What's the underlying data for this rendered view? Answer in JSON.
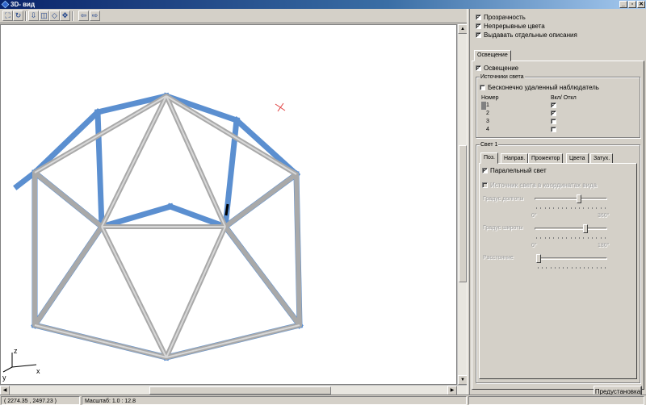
{
  "window": {
    "title": "3D- вид",
    "buttons": [
      "_",
      "▫",
      "✕"
    ]
  },
  "toolbar": {
    "buttons": [
      {
        "icon": "zoom-fit-icon",
        "glyph": "⛶"
      },
      {
        "icon": "refresh-icon",
        "glyph": "↻"
      },
      {
        "icon": "pan-down-icon",
        "glyph": "⇩"
      },
      {
        "icon": "view-front-icon",
        "glyph": "◫"
      },
      {
        "icon": "view-top-icon",
        "glyph": "◇"
      },
      {
        "icon": "move-icon",
        "glyph": "✥"
      },
      {
        "icon": "undo-icon",
        "glyph": "⇦"
      },
      {
        "icon": "redo-icon",
        "glyph": "⇨"
      }
    ]
  },
  "viewport": {
    "axes": {
      "z": "z",
      "x": "x",
      "y": "y"
    }
  },
  "status": {
    "coords": "( 2274.35 , 2497.23 )",
    "scale": "Масштаб: 1.0 : 12.8"
  },
  "panel": {
    "transparency": {
      "label": "Прозрачность",
      "checked": true
    },
    "continuous_colors": {
      "label": "Непрерывные цвета",
      "checked": true
    },
    "separate_desc": {
      "label": "Выдавать отдельные описания",
      "checked": true
    },
    "lighting_tab": "Освещение",
    "lighting": {
      "label": "Освещение",
      "checked": true
    },
    "sources_group": "Источники света",
    "infinite_observer": {
      "label": "Бесконечно удаленный наблюдатель",
      "checked": false
    },
    "list_headers": {
      "num": "Номер",
      "onoff": "Вкл/ Откл"
    },
    "lights": [
      {
        "num": "1",
        "on": true
      },
      {
        "num": "2",
        "on": true
      },
      {
        "num": "3",
        "on": false
      },
      {
        "num": "4",
        "on": false
      }
    ],
    "light_group": "Свет 1",
    "light_tabs": [
      "Поз.",
      "Направ.",
      "Прожектор",
      "Цвета",
      "Затух."
    ],
    "parallel_light": {
      "label": "Паралельный свет",
      "checked": true
    },
    "view_coords": {
      "label": "Источник света в координатах вида",
      "checked": false
    },
    "longitude": {
      "label": "Градус долготы",
      "min": "0°",
      "max": "360°",
      "value_fraction": 0.62
    },
    "latitude": {
      "label": "Градус широты",
      "min": "0°",
      "max": "180°",
      "value_fraction": 0.72
    },
    "distance": {
      "label": "Расстояние",
      "value_fraction": 0.0
    },
    "preset_button": "Предустановка"
  },
  "colors": {
    "frame_blue": "#5b8fd0",
    "frame_gray": "#b8b8b8",
    "title_blue": "#0a246a"
  }
}
